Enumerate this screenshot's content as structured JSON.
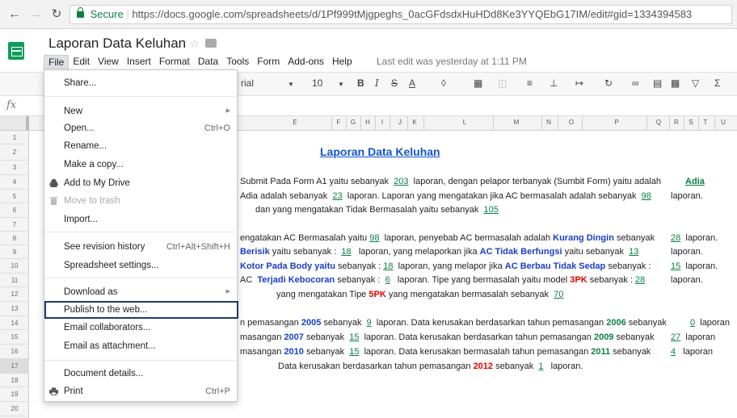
{
  "browser": {
    "secure_label": "Secure",
    "url": "https://docs.google.com/spreadsheets/d/1Pf999tMjgpeghs_0acGFdsdxHuHDd8Ke3YYQEbG17IM/edit#gid=1334394583"
  },
  "doc": {
    "title": "Laporan Data Keluhan",
    "last_edit": "Last edit was yesterday at 1:11 PM"
  },
  "menu": [
    "File",
    "Edit",
    "View",
    "Insert",
    "Format",
    "Data",
    "Tools",
    "Form",
    "Add-ons",
    "Help"
  ],
  "toolbar": {
    "font_name": "rial",
    "font_size": "10"
  },
  "columns": [
    "E",
    "F",
    "G",
    "H",
    "I",
    "J",
    "K",
    "L",
    "M",
    "N",
    "O",
    "P",
    "Q",
    "R",
    "S",
    "T",
    "U"
  ],
  "rows": [
    "1",
    "2",
    "3",
    "4",
    "5",
    "6",
    "7",
    "8",
    "9",
    "10",
    "11",
    "12",
    "13",
    "14",
    "15",
    "16",
    "17",
    "18",
    "19",
    "20"
  ],
  "file_menu": {
    "share": "Share...",
    "new": "New",
    "open": "Open...",
    "open_shortcut": "Ctrl+O",
    "rename": "Rename...",
    "make_copy": "Make a copy...",
    "add_drive": "Add to My Drive",
    "trash": "Move to trash",
    "import": "Import...",
    "revision": "See revision history",
    "revision_shortcut": "Ctrl+Alt+Shift+H",
    "settings": "Spreadsheet settings...",
    "download": "Download as",
    "publish": "Publish to the web...",
    "email_collab": "Email collaborators...",
    "email_attach": "Email as attachment...",
    "details": "Document details...",
    "print": "Print",
    "print_shortcut": "Ctrl+P"
  },
  "sheet": {
    "title": "Laporan Data Keluhan",
    "r4a": "Submit Pada Form A1 yaitu sebanyak",
    "r4n1": "203",
    "r4b": "laporan, dengan pelapor terbanyak (Sumbit Form) yaitu adalah",
    "r4c": "Adia",
    "r5a": "Adia adalah sebanyak",
    "r5n1": "23",
    "r5b": "laporan. Laporan yang mengatakan jika AC bermasalah adalah sebanyak",
    "r5n2": "98",
    "r5c": "laporan.",
    "r6a": "dan yang mengatakan Tidak Bermasalah yaitu sebanyak",
    "r6n1": "105",
    "r8a": "engatakan AC Bermasalah yaitu",
    "r8n1": "98",
    "r8b": "laporan, penyebab AC bermasalah adalah",
    "r8c": "Kurang Dingin",
    "r8d": "sebanyak",
    "r8n2": "28",
    "r8e": "laporan.",
    "r9a": "Berisik",
    "r9b": "yaitu sebanyak :",
    "r9n1": "18",
    "r9c": "laporan,  yang melaporkan jika",
    "r9d": "AC Tidak Berfungsi",
    "r9e": "yaitu sebanyak",
    "r9n2": "13",
    "r9f": "laporan.",
    "r10a": "Kotor Pada Body yaitu",
    "r10b": "sebanyak :",
    "r10n1": "18",
    "r10c": "laporan, yang melapor jika",
    "r10d": "AC Berbau Tidak Sedap",
    "r10e": "sebanyak :",
    "r10n2": "15",
    "r10f": "laporan.",
    "r11a": "AC",
    "r11b": "Terjadi Kebocoran",
    "r11c": "sebanyak :",
    "r11n1": "6",
    "r11d": "laporan. Tipe yang bermasalah yaitu model",
    "r11e": "3PK",
    "r11f": "sebanyak :",
    "r11n2": "28",
    "r11g": "laporan.",
    "r12a": "yang mengatakan Tipe",
    "r12b": "5PK",
    "r12c": "yang mengatakan bermasalah sebanyak",
    "r12n1": "70",
    "r14a": "n pemasangan",
    "r14b": "2005",
    "r14c": "sebanyak",
    "r14n1": "9",
    "r14d": "laporan. Data kerusakan berdasarkan tahun pemasangan",
    "r14e": "2006",
    "r14f": "sebanyak",
    "r14n2": "0",
    "r14g": "laporan",
    "r15a": "masangan",
    "r15b": "2007",
    "r15c": "sebanyak",
    "r15n1": "15",
    "r15d": "laporan. Data kerusakan berdasarkan tahun pemasangan",
    "r15e": "2009",
    "r15f": "sebanyak",
    "r15n2": "27",
    "r15g": "laporan",
    "r16a": "masangan",
    "r16b": "2010",
    "r16c": "sebanyak",
    "r16n1": "15",
    "r16d": "laporan. Data kerusakan bermasalah tahun pemasangan",
    "r16e": "2011",
    "r16f": "sebanyak",
    "r16n2": "4",
    "r16g": "laporan",
    "r17a": "Data kerusakan berdasarkan tahun pemasangan",
    "r17b": "2012",
    "r17c": "sebanyak",
    "r17n1": "1",
    "r17d": "laporan."
  }
}
